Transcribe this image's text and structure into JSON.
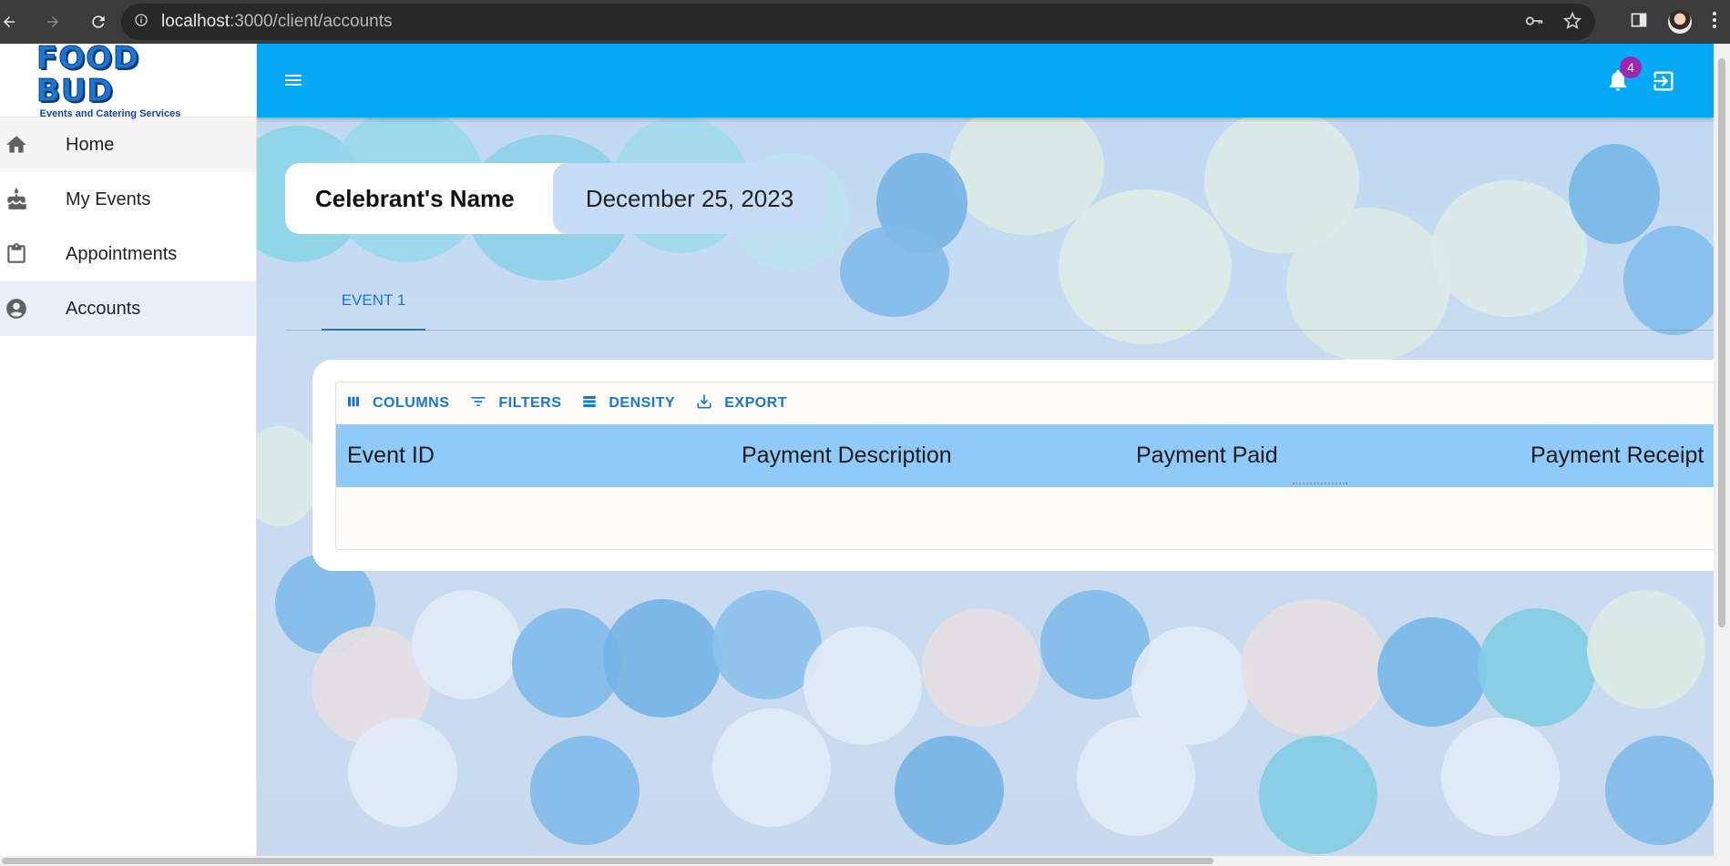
{
  "browser": {
    "url_host": "localhost",
    "url_path": ":3000/client/accounts"
  },
  "sidebar": {
    "logo_text": "FOOD BUD",
    "logo_subtitle": "Events and Catering Services",
    "items": [
      {
        "label": "Home",
        "icon": "home-icon"
      },
      {
        "label": "My Events",
        "icon": "cake-icon"
      },
      {
        "label": "Appointments",
        "icon": "clipboard-icon"
      },
      {
        "label": "Accounts",
        "icon": "account-circle-icon"
      }
    ],
    "active": "Accounts"
  },
  "appbar": {
    "notification_count": "4"
  },
  "header": {
    "celebrant_name": "Celebrant's Name",
    "event_date": "December 25, 2023"
  },
  "tabs": [
    {
      "label": "EVENT 1"
    }
  ],
  "grid": {
    "toolbar": {
      "columns": "COLUMNS",
      "filters": "FILTERS",
      "density": "DENSITY",
      "export": "EXPORT"
    },
    "columns": [
      "Event ID",
      "Payment Description",
      "Payment Paid",
      "Payment Receipt"
    ]
  },
  "colors": {
    "appbar": "#03a9f4",
    "accent": "#1976d2",
    "grid_header": "#90caf9",
    "badge": "#9c27b0",
    "date_chip": "#c6dcf7"
  }
}
